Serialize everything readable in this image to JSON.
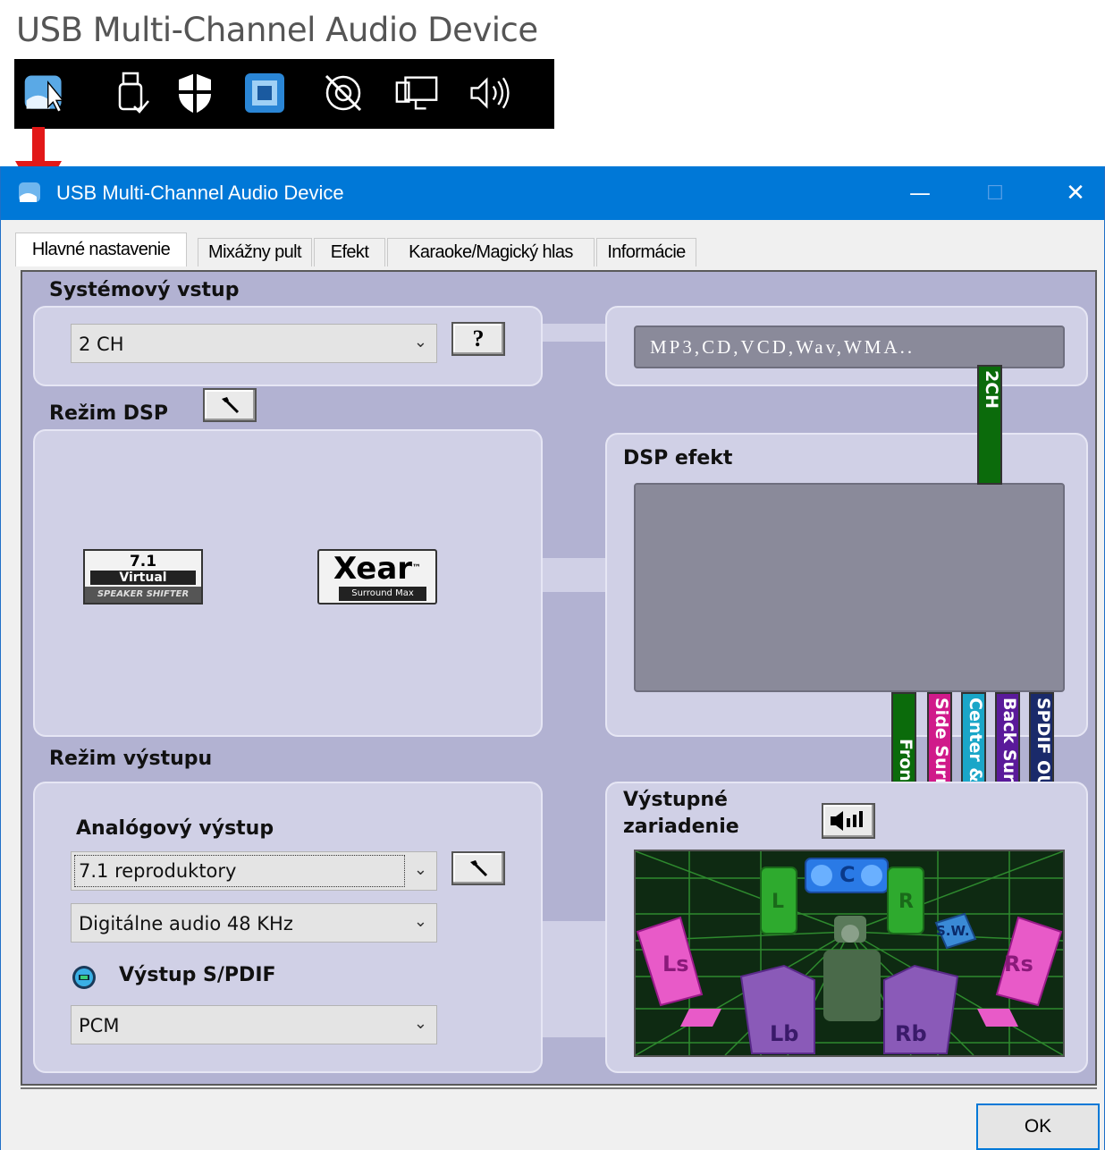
{
  "header": {
    "title": "USB Multi-Channel Audio Device"
  },
  "tray_icons": [
    "audio-device-icon",
    "cursor-icon",
    "usb-drive-icon",
    "shield-icon",
    "network-icon",
    "speaker-icon",
    "monitor-icon",
    "volume-icon"
  ],
  "window": {
    "title": "USB Multi-Channel Audio Device",
    "minimize": "—",
    "maximize": "☐",
    "close": "✕"
  },
  "tabs": [
    {
      "label": "Hlavné nastavenie",
      "active": true
    },
    {
      "label": "Mixážny pult",
      "active": false
    },
    {
      "label": "Efekt",
      "active": false
    },
    {
      "label": "Karaoke/Magický hlas",
      "active": false
    },
    {
      "label": "Informácie",
      "active": false
    }
  ],
  "system_input": {
    "title": "Systémový vstup",
    "value": "2 CH",
    "help_label": "?",
    "source_text": "MP3,CD,VCD,Wav,WMA.."
  },
  "dsp_mode": {
    "title": "Režim DSP",
    "badge_virtual": {
      "top": "7.1",
      "mid": "Virtual",
      "bottom": "SPEAKER SHIFTER"
    },
    "badge_xear": {
      "main": "Xear",
      "tm": "™",
      "sub": "Surround Max"
    }
  },
  "dsp_effect": {
    "title": "DSP efekt"
  },
  "channels": {
    "input": {
      "label": "2CH",
      "color": "#0b6b0b"
    },
    "outputs": [
      {
        "label": "Front",
        "color": "#0b6b0b"
      },
      {
        "label": "Side Surround",
        "color": "#d01a8a"
      },
      {
        "label": "Center & Sub",
        "color": "#1aa6c8"
      },
      {
        "label": "Back Surround",
        "color": "#5a1a9a"
      },
      {
        "label": "SPDIF OUT",
        "color": "#1a2a6a"
      }
    ]
  },
  "output_mode": {
    "title": "Režim výstupu",
    "analog_label": "Analógový výstup",
    "analog_value": "7.1 reproduktory",
    "digital_value": "Digitálne audio 48 KHz",
    "spdif_label": "Výstup S/PDIF",
    "spdif_value": "PCM"
  },
  "output_device": {
    "title_line1": "Výstupné",
    "title_line2": "zariadenie",
    "speakers": {
      "c": "C",
      "l": "L",
      "r": "R",
      "sw": "S.W.",
      "ls": "Ls",
      "rs": "Rs",
      "lb": "Lb",
      "rb": "Rb"
    }
  },
  "ok_label": "OK",
  "colors": {
    "titlebar": "#0078d7",
    "panel": "#b2b2d2",
    "box": "#d0d0e6",
    "arrow": "#e21818"
  }
}
